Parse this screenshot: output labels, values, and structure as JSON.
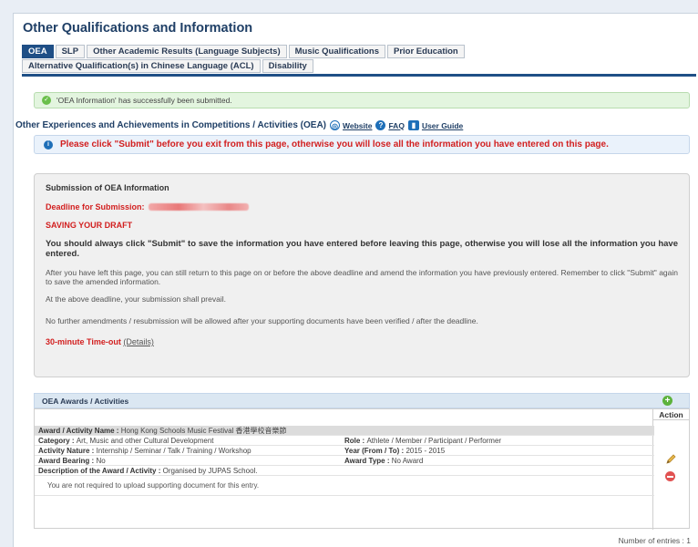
{
  "page": {
    "title": "Other Qualifications and Information"
  },
  "tabs": [
    {
      "label": "OEA",
      "active": true
    },
    {
      "label": "SLP",
      "active": false
    },
    {
      "label": "Other Academic Results (Language Subjects)",
      "active": false
    },
    {
      "label": "Music Qualifications",
      "active": false
    },
    {
      "label": "Prior Education",
      "active": false
    },
    {
      "label": "Alternative Qualification(s) in Chinese Language (ACL)",
      "active": false
    },
    {
      "label": "Disability",
      "active": false
    }
  ],
  "success_message": "'OEA Information' has successfully been submitted.",
  "oea_section": {
    "heading": "Other Experiences and Achievements in Competitions / Activities (OEA)",
    "website_link": "Website",
    "faq_link": "FAQ",
    "guide_link": "User Guide"
  },
  "notice": "Please click \"Submit\" before you exit from this page, otherwise you will lose all the information you have entered on this page.",
  "submission_panel": {
    "title": "Submission of OEA Information",
    "deadline_label": "Deadline for Submission:",
    "draft_heading": "SAVING YOUR DRAFT",
    "bold_text": "You should always click \"Submit\" to save the information you have entered before leaving this page, otherwise you will lose all the information you have entered.",
    "after_text": "After you have left this page, you can still return to this page on or before the above deadline and amend the information you have previously entered. Remember to click \"Submit\" again to save the amended information.",
    "prevail_text": "At the above deadline, your submission shall prevail.",
    "no_amend_text": "No further amendments / resubmission will be allowed after your supporting documents have been verified / after the deadline.",
    "timeout_label": "30-minute Time-out",
    "details_link": "(Details)"
  },
  "awards": {
    "bar_title": "OEA Awards / Activities",
    "action_header": "Action",
    "entry": {
      "name_label": "Award / Activity Name :",
      "name_value": "Hong Kong Schools Music Festival 香港學校音樂節",
      "category_label": "Category :",
      "category_value": "Art, Music and other Cultural Development",
      "role_label": "Role :",
      "role_value": "Athlete / Member / Participant / Performer",
      "nature_label": "Activity Nature :",
      "nature_value": "Internship / Seminar / Talk / Training / Workshop",
      "year_label": "Year (From / To) :",
      "year_value": "2015 - 2015",
      "bearing_label": "Award Bearing :",
      "bearing_value": "No",
      "type_label": "Award Type :",
      "type_value": "No Award",
      "desc_label": "Description of the Award / Activity :",
      "desc_value": "Organised by JUPAS School.",
      "upload_note": "You are not required to upload supporting document for this entry."
    },
    "count_text": "Number of entries : 1"
  },
  "icons": {
    "success": "check-circle-icon",
    "website": "globe-icon",
    "faq": "help-icon",
    "guide": "book-icon",
    "info": "info-icon",
    "add": "add-icon",
    "edit": "pencil-icon",
    "delete": "delete-icon"
  },
  "colors": {
    "brand": "#1f4f86",
    "alert_red": "#d21f1f",
    "success_bg": "#e3f5df"
  }
}
